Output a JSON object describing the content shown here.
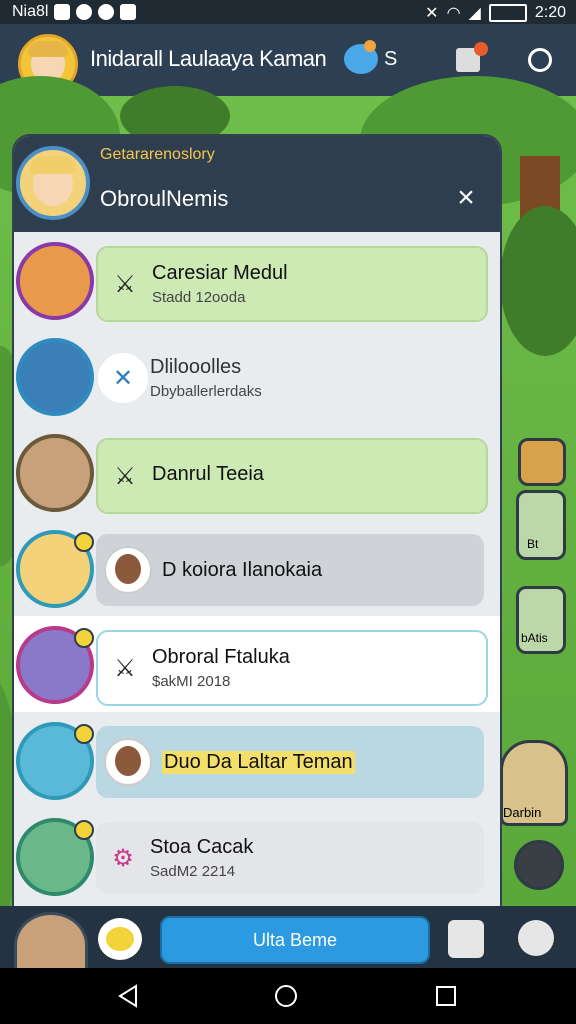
{
  "status_bar": {
    "carrier": "Nia8l",
    "time": "2:20"
  },
  "top_bar": {
    "title": "Inidarall Laulaaya Kaman",
    "currency_value": "S"
  },
  "panel": {
    "subtitle": "Getararenoslory",
    "title": "ObroulNemis",
    "close_label": "×"
  },
  "rows": [
    {
      "title": "Caresiar Medul",
      "subtitle": "Stadd 12ooda",
      "icon": "sword-icon",
      "card_color": "#cdeab4"
    },
    {
      "title": "Dlilooolles",
      "subtitle": "Dbyballerlerdaks",
      "icon": "crossed-swords-icon",
      "card_color": "#e9ecef"
    },
    {
      "title": "Danrul Teeia",
      "subtitle": "",
      "icon": "sword-icon",
      "card_color": "#cdeab4"
    },
    {
      "title": "D koiora Ilanokaia",
      "subtitle": "",
      "icon": "avatar-icon",
      "card_color": "#cfd3d7"
    },
    {
      "title": "Obroral Ftaluka",
      "subtitle": "$akMI 2018",
      "icon": "sword-icon",
      "card_color": "#ffffff"
    },
    {
      "title": "Duo Da Laltar Teman",
      "subtitle": "",
      "icon": "avatar-icon",
      "card_color": "#b9d8e2"
    },
    {
      "title": "Stoa Cacak",
      "subtitle": "SadM2 2214",
      "icon": "bike-icon",
      "card_color": "#e3e5e8"
    }
  ],
  "side_items": {
    "label1": "Bt",
    "label2": "bAtis",
    "label3": "Darbin"
  },
  "bottom_bar": {
    "main_button": "Ulta Beme"
  },
  "colors": {
    "accent": "#2b9ae0",
    "header": "#2e3e4f",
    "subtitle": "#f5c84a"
  }
}
